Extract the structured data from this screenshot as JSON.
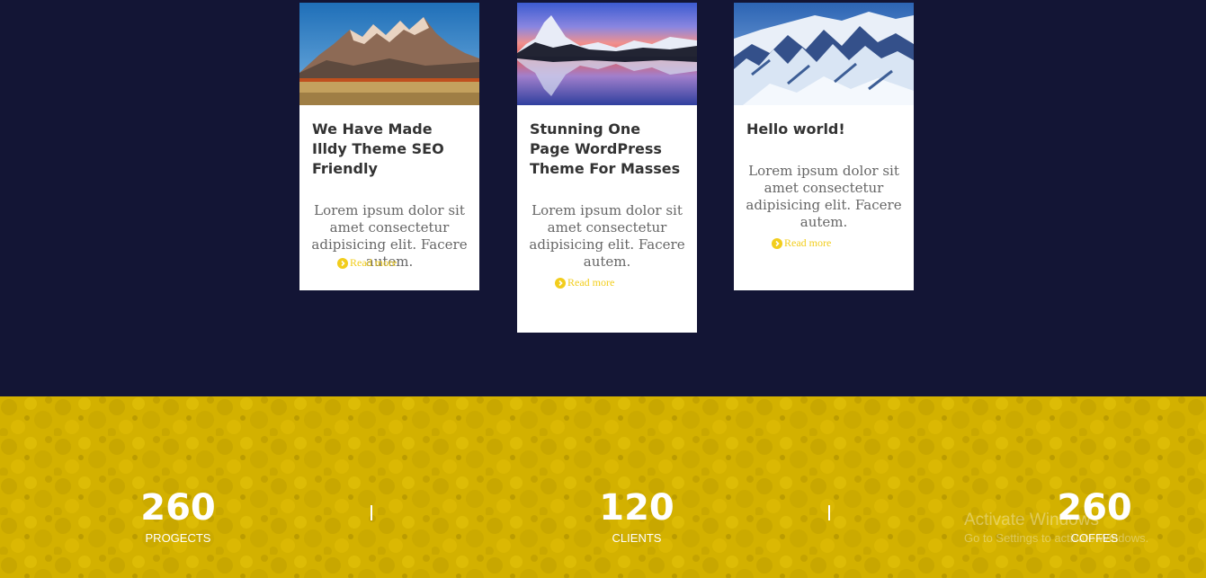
{
  "posts": [
    {
      "title": "We Have Made Illdy Theme SEO Friendly",
      "excerpt": "Lorem ipsum dolor sit amet consectetur adipisicing elit. Facere autem.",
      "read_more": "Read more",
      "image": "mountain-sunset-photo"
    },
    {
      "title": "Stunning One Page WordPress Theme For Masses",
      "excerpt": "Lorem ipsum dolor sit amet consectetur adipisicing elit. Facere autem.",
      "read_more": "Read more",
      "image": "lake-reflection-photo"
    },
    {
      "title": "Hello world!",
      "excerpt": "Lorem ipsum dolor sit amet consectetur adipisicing elit. Facere autem.",
      "read_more": "Read more",
      "image": "snowy-mountains-photo"
    }
  ],
  "counters": [
    {
      "number": "260",
      "label": "PROGECTS"
    },
    {
      "number": "120",
      "label": "CLIENTS"
    },
    {
      "number": "260",
      "label": "COFFES"
    }
  ],
  "watermark": {
    "title": "Activate Windows",
    "subtitle": "Go to Settings to activate Windows."
  },
  "colors": {
    "posts_background": "#131535",
    "counters_background": "#d4b200",
    "accent": "#f2cd1c",
    "card_background": "#ffffff"
  }
}
